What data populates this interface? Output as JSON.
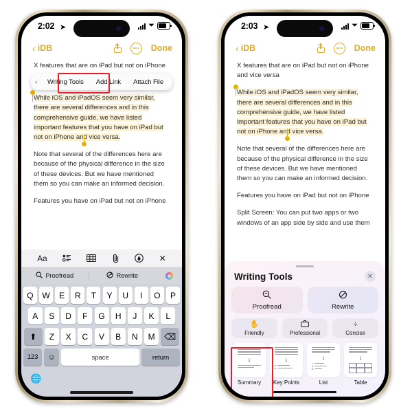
{
  "left_phone": {
    "status": {
      "time": "2:02",
      "location_icon": "location-arrow-icon",
      "battery": "full"
    },
    "nav": {
      "back_label": "iDB",
      "done_label": "Done"
    },
    "note": {
      "title_line": "X features that are on iPad but not on iPhone",
      "selected_paragraph": "While iOS and iPadOS seem very similar, there are several differences and in this comprehensive guide, we have listed important features that you have on iPad but not on iPhone and vice versa.",
      "paragraph_2": "Note that several of the differences here are because of the physical difference in the size of these devices. But we have mentioned them so you can make an informed decision.",
      "paragraph_3": "Features you have on iPad but not on iPhone"
    },
    "context_menu": {
      "prev_arrow": "‹",
      "next_arrow": "›",
      "items": [
        "Writing Tools",
        "Add Link",
        "Attach File"
      ],
      "highlighted": "Writing Tools"
    },
    "format_bar": {
      "items": [
        "Aa",
        "checklist-icon",
        "table-icon",
        "paperclip-icon",
        "markup-icon",
        "close-icon"
      ]
    },
    "ai_row": {
      "proofread_label": "Proofread",
      "rewrite_label": "Rewrite",
      "sparkle_icon": "apple-intelligence-icon"
    },
    "keyboard": {
      "row1": [
        "Q",
        "W",
        "E",
        "R",
        "T",
        "Y",
        "U",
        "I",
        "O",
        "P"
      ],
      "row2": [
        "A",
        "S",
        "D",
        "F",
        "G",
        "H",
        "J",
        "K",
        "L"
      ],
      "row3": [
        "Z",
        "X",
        "C",
        "V",
        "B",
        "N",
        "M"
      ],
      "shift_icon": "shift-up-icon",
      "delete_icon": "backspace-icon",
      "numbers_label": "123",
      "emoji_icon": "emoji-icon",
      "space_label": "space",
      "return_label": "return",
      "globe_icon": "globe-icon"
    }
  },
  "right_phone": {
    "status": {
      "time": "2:03",
      "location_icon": "location-arrow-icon",
      "battery": "full"
    },
    "nav": {
      "back_label": "iDB",
      "done_label": "Done"
    },
    "note": {
      "title_line": "X features that are on iPad but not on iPhone and vice versa",
      "selected_paragraph": "While iOS and iPadOS seem very similar, there are several differences and in this comprehensive guide, we have listed important features that you have on iPad but not on iPhone and vice versa.",
      "paragraph_2": "Note that several of the differences here are because of the physical difference in the size of these devices. But we have mentioned them so you can make an informed decision.",
      "paragraph_3": "Features you have on iPad but not on iPhone",
      "paragraph_4": "Split Screen: You can put two apps or two windows of an app side by side and use them"
    },
    "sheet": {
      "title": "Writing Tools",
      "close_icon": "close-icon",
      "primary": [
        {
          "label": "Proofread",
          "icon": "magnifier-icon"
        },
        {
          "label": "Rewrite",
          "icon": "rewrite-arrow-icon"
        }
      ],
      "tones": [
        {
          "label": "Friendly",
          "icon": "hand-wave-icon"
        },
        {
          "label": "Professional",
          "icon": "briefcase-icon"
        },
        {
          "label": "Concise",
          "icon": "divide-icon"
        }
      ],
      "formats": [
        {
          "label": "Summary",
          "icon": "summary-doc-icon",
          "highlighted": true
        },
        {
          "label": "Key Points",
          "icon": "key-points-doc-icon",
          "highlighted": false
        },
        {
          "label": "List",
          "icon": "list-doc-icon",
          "highlighted": false
        },
        {
          "label": "Table",
          "icon": "table-doc-icon",
          "highlighted": false
        }
      ]
    }
  },
  "colors": {
    "accent_gold": "#e2ab27",
    "highlight_yellow": "#fbf2d8",
    "annotation_red": "#ee1c25",
    "keyboard_bg": "#d1d4dc"
  }
}
